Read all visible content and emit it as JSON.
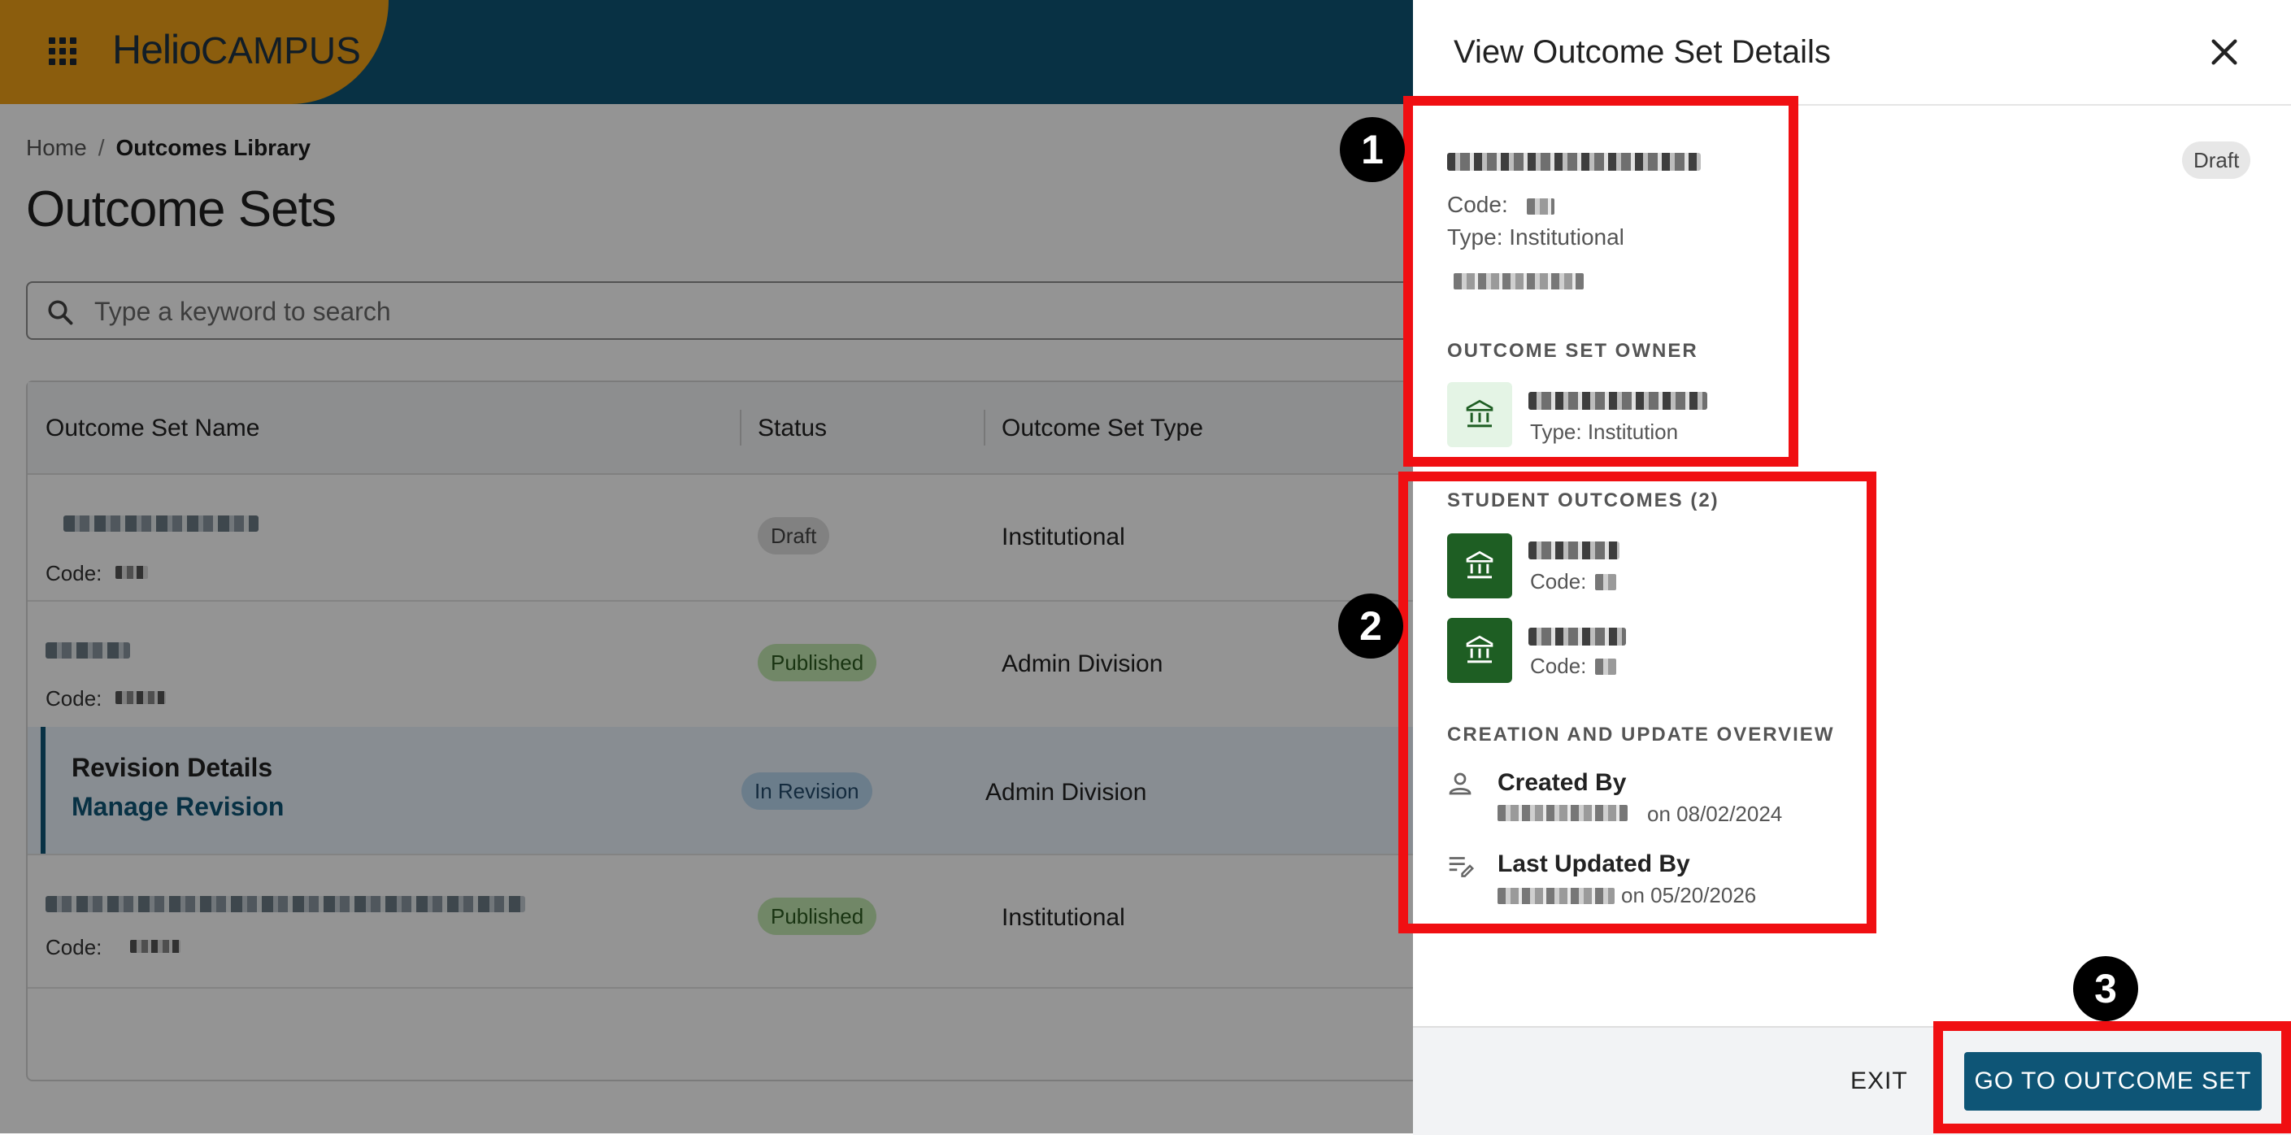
{
  "header": {
    "brand_primary": "Helio",
    "brand_secondary": "CAMPUS"
  },
  "breadcrumb": {
    "home": "Home",
    "separator": "/",
    "current": "Outcomes Library"
  },
  "page": {
    "title": "Outcome Sets"
  },
  "search": {
    "placeholder": "Type a keyword to search"
  },
  "table": {
    "columns": [
      "Outcome Set Name",
      "Status",
      "Outcome Set Type"
    ],
    "rows": [
      {
        "code_label": "Code:",
        "status": "Draft",
        "type": "Institutional"
      },
      {
        "code_label": "Code:",
        "status": "Published",
        "type": "Admin Division"
      },
      {
        "revision_title": "Revision Details",
        "revision_link": "Manage Revision",
        "status": "In Revision",
        "type": "Admin Division"
      },
      {
        "code_label": "Code:",
        "status": "Published",
        "type": "Institutional"
      }
    ]
  },
  "drawer": {
    "title": "View Outcome Set Details",
    "status_chip": "Draft",
    "code_label": "Code:",
    "type_label": "Type: Institutional",
    "owner_section": "OUTCOME SET OWNER",
    "owner_type": "Type: Institution",
    "student_outcomes_section": "STUDENT OUTCOMES (2)",
    "student_outcomes": [
      {
        "code_label": "Code:"
      },
      {
        "code_label": "Code:"
      }
    ],
    "overview_section": "CREATION AND UPDATE OVERVIEW",
    "created_by_label": "Created By",
    "created_on": "on 08/02/2024",
    "updated_by_label": "Last Updated By",
    "updated_on": "on 05/20/2026",
    "exit_label": "EXIT",
    "go_label": "GO TO OUTCOME SET"
  },
  "annotations": {
    "callouts": [
      "1",
      "2",
      "3"
    ],
    "highlight_color": "#f00f12"
  },
  "colors": {
    "topbar": "#0e5576",
    "brand_accent": "#f0a018",
    "primary_button": "#0e5576",
    "institution_icon_dark": "#1e5e23",
    "institution_icon_light": "#e4f4e5"
  }
}
